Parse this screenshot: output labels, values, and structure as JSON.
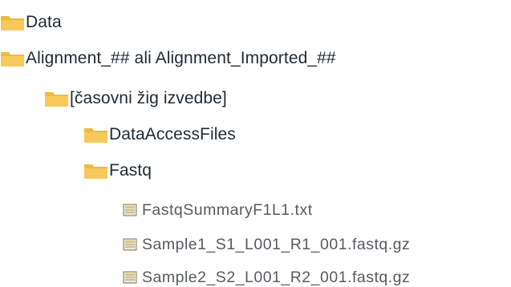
{
  "tree": {
    "items": [
      {
        "label": "Data",
        "type": "folder",
        "icon": "folder-icon"
      },
      {
        "label": "Alignment_## ali Alignment_Imported_##",
        "type": "folder",
        "icon": "folder-icon"
      },
      {
        "label": "[časovni žig izvedbe]",
        "type": "folder",
        "icon": "folder-icon"
      },
      {
        "label": "DataAccessFiles",
        "type": "folder",
        "icon": "folder-icon"
      },
      {
        "label": "Fastq",
        "type": "folder",
        "icon": "folder-icon"
      },
      {
        "label": "FastqSummaryF1L1.txt",
        "type": "file",
        "icon": "file-icon"
      },
      {
        "label": "Sample1_S1_L001_R1_001.fastq.gz",
        "type": "file",
        "icon": "file-icon"
      },
      {
        "label": "Sample2_S2_L001_R2_001.fastq.gz",
        "type": "file",
        "icon": "file-icon"
      }
    ]
  },
  "colors": {
    "folder_fill": "#f7c95a",
    "folder_back": "#efb93f",
    "text": "#1f2a34",
    "file_text": "#555b61"
  }
}
